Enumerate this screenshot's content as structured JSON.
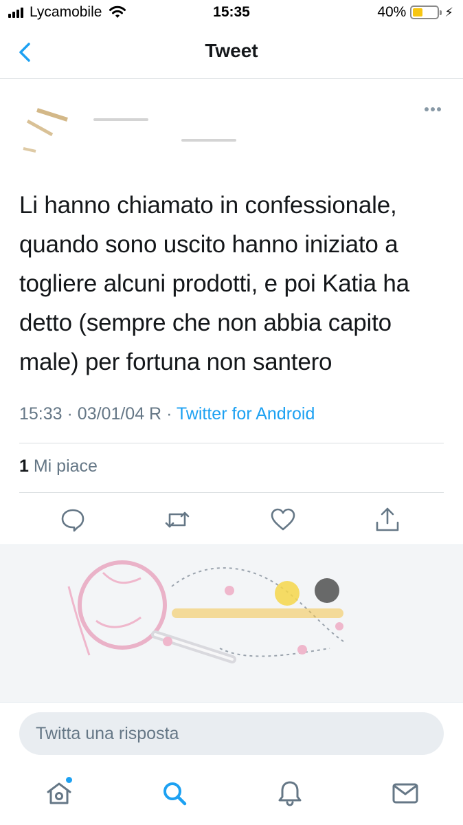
{
  "status_bar": {
    "carrier": "Lycamobile",
    "time": "15:35",
    "battery_percent": "40%",
    "battery_level": 0.4,
    "battery_color": "#f7c612"
  },
  "nav": {
    "title": "Tweet",
    "back_icon": "chevron-left-icon"
  },
  "tweet": {
    "text": "Li hanno chiamato in confessionale, quando sono uscito hanno iniziato a togliere alcuni prodotti, e poi Katia ha detto (sempre che non abbia capito male) per fortuna non santero",
    "time": "15:33",
    "date": "03/01/04 R",
    "source": "Twitter for Android",
    "likes_count": "1",
    "likes_label": "Mi piace"
  },
  "actions": [
    "reply-icon",
    "retweet-icon",
    "like-icon",
    "share-icon"
  ],
  "reply": {
    "placeholder": "Twitta una risposta"
  },
  "tab_bar": [
    "home-icon",
    "search-icon",
    "notifications-icon",
    "messages-icon"
  ],
  "colors": {
    "accent": "#1da1f2",
    "secondary_text": "#657786",
    "primary_text": "#14171a"
  }
}
